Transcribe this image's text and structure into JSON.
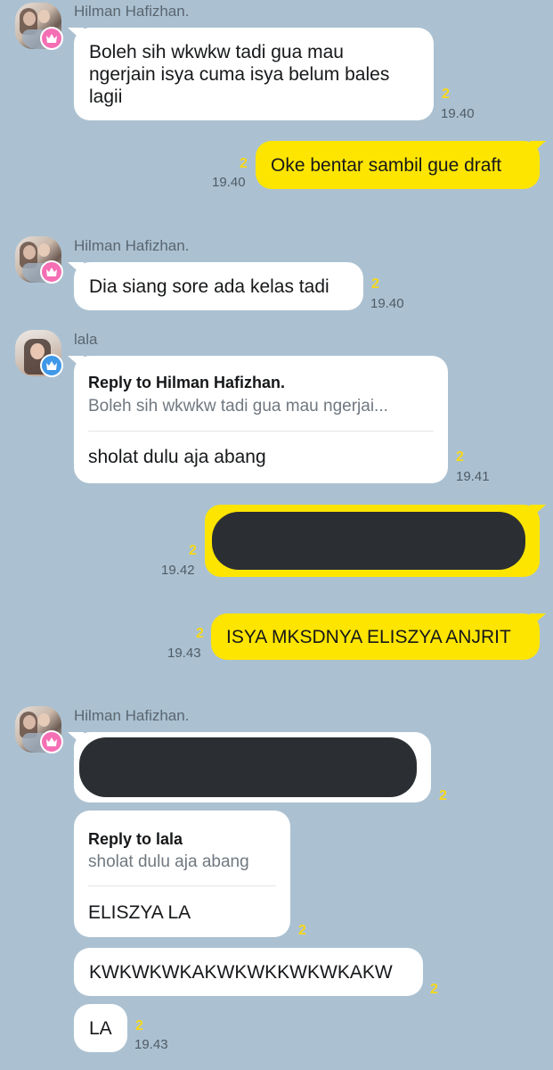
{
  "colors": {
    "background": "#abc1d1",
    "bubble_incoming": "#ffffff",
    "bubble_outgoing": "#fee500",
    "unread_count": "#f7d81a",
    "redaction": "#2b2f33"
  },
  "messages": [
    {
      "sender": "Hilman Hafizhan.",
      "lines": [
        "Boleh sih wkwkw tadi gua mau",
        "ngerjain isya cuma isya belum bales",
        "lagii"
      ],
      "unread": "2",
      "time": "19.40"
    },
    {
      "sender": "me",
      "text": "Oke bentar sambil gue draft",
      "unread": "2",
      "time": "19.40"
    },
    {
      "sender": "Hilman Hafizhan.",
      "text": "Dia siang sore ada kelas tadi",
      "unread": "2",
      "time": "19.40"
    },
    {
      "sender": "lala",
      "reply_title": "Reply to Hilman Hafizhan.",
      "reply_quote": "Boleh sih wkwkw tadi gua mau ngerjai...",
      "text": "sholat dulu aja abang",
      "unread": "2",
      "time": "19.41"
    },
    {
      "sender": "me",
      "redacted": true,
      "unread": "2",
      "time": "19.42"
    },
    {
      "sender": "me",
      "text": "ISYA MKSDNYA ELISZYA ANJRIT",
      "unread": "2",
      "time": "19.43"
    },
    {
      "sender": "Hilman Hafizhan.",
      "redacted": true,
      "unread": "2"
    },
    {
      "sender": "Hilman Hafizhan.",
      "reply_title": "Reply to lala",
      "reply_quote": "sholat dulu aja abang",
      "text": "ELISZYA LA",
      "unread": "2"
    },
    {
      "sender": "Hilman Hafizhan.",
      "text": "KWKWKWKAKWKWKKWKWKAKW",
      "unread": "2"
    },
    {
      "sender": "Hilman Hafizhan.",
      "text": "LA",
      "unread": "2",
      "time": "19.43"
    }
  ]
}
